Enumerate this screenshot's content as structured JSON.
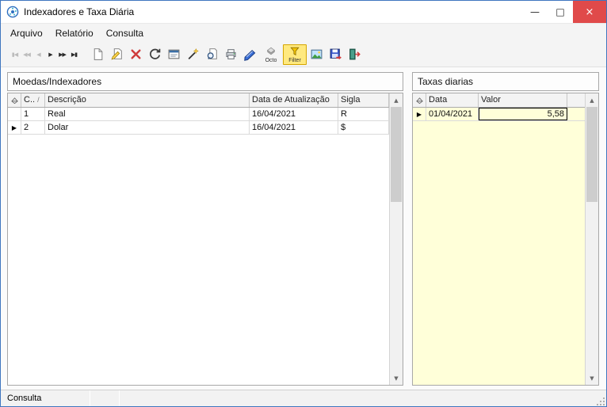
{
  "window": {
    "title": "Indexadores e Taxa Diária",
    "controls": {
      "minimize": "—",
      "maximize": "□",
      "close": "×"
    }
  },
  "menu": {
    "items": [
      {
        "label": "Arquivo"
      },
      {
        "label": "Relatório"
      },
      {
        "label": "Consulta"
      }
    ]
  },
  "toolbar": {
    "nav_buttons": [
      {
        "name": "first",
        "glyph": "▮◀",
        "enabled": false
      },
      {
        "name": "prior-page",
        "glyph": "◀◀",
        "enabled": false
      },
      {
        "name": "prior",
        "glyph": "◀",
        "enabled": false
      },
      {
        "name": "next",
        "glyph": "▶",
        "enabled": true
      },
      {
        "name": "next-page",
        "glyph": "▶▶",
        "enabled": true
      },
      {
        "name": "last",
        "glyph": "▶▮",
        "enabled": true
      }
    ],
    "icon_buttons": [
      "new-record",
      "edit-record",
      "delete-record",
      "refresh",
      "properties",
      "wand",
      "print-preview",
      "print",
      "book",
      "octo",
      "filter",
      "picture",
      "save-export",
      "exit"
    ],
    "octo_label": "Octo",
    "filter_label": "Filter"
  },
  "panels": {
    "left": {
      "title": "Moedas/Indexadores",
      "columns": [
        {
          "label": "C.."
        },
        {
          "label": "Descrição"
        },
        {
          "label": "Data de Atualização"
        },
        {
          "label": "Sigla"
        }
      ],
      "rows": [
        {
          "codigo": "1",
          "descricao": "Real",
          "data_atualizacao": "16/04/2021",
          "sigla": "R",
          "selected": false
        },
        {
          "codigo": "2",
          "descricao": "Dolar",
          "data_atualizacao": "16/04/2021",
          "sigla": "$",
          "selected": true
        }
      ]
    },
    "right": {
      "title": "Taxas diarias",
      "columns": [
        {
          "label": "Data"
        },
        {
          "label": "Valor"
        }
      ],
      "rows": [
        {
          "data": "01/04/2021",
          "valor": "5,58",
          "selected": true
        }
      ]
    }
  },
  "statusbar": {
    "panel1": "Consulta"
  },
  "icons": {
    "row_indicator": "▶",
    "sort_asc": "/",
    "scroll_up": "▲",
    "scroll_down": "▼"
  },
  "colors": {
    "border_blue": "#3f76bf",
    "close_red": "#e04a4a",
    "grid_yellow": "#ffffd9",
    "filter_highlight": "#ffe97f"
  }
}
